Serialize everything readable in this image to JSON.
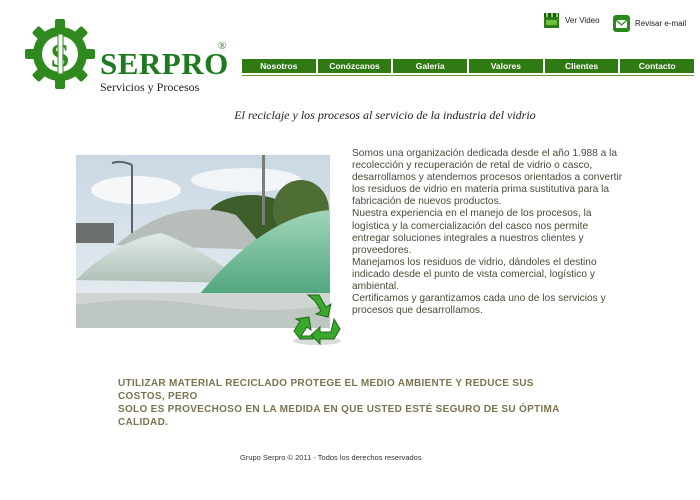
{
  "logo": {
    "name": "SERPRO",
    "registered": "®",
    "subtitle": "Servicios y Procesos"
  },
  "top_links": {
    "video": "Ver Video",
    "email": "Revisar  e-mail"
  },
  "nav": [
    "Nosotros",
    "Conózcanos",
    "Galeria",
    "Valores",
    "Clientes",
    "Contacto"
  ],
  "tagline": "El reciclaje y los procesos al servicio de la industria del vidrio",
  "body": [
    "Somos  una organización dedicada desde el año 1.988 a la recolección y recuperación de retal de vidrio o casco, desarrollamos y atendemos procesos orientados a convertir los residuos de vidrio  en materia prima sustitutiva para la fabricación de nuevos productos.",
    "Nuestra experiencia en el manejo de los procesos, la logística y  la comercialización del casco nos permite entregar soluciones integrales a  nuestros clientes y proveedores.",
    "Manejamos los residuos de vidrio, dándoles el destino indicado desde el punto de vista comercial, logístico y ambiental.",
    "Certificamos y garantizamos cada uno de los servicios y procesos que desarrollamos."
  ],
  "slogan": {
    "line1": "UTILIZAR MATERIAL RECICLADO PROTEGE EL MEDIO AMBIENTE Y REDUCE SUS COSTOS, PERO",
    "line2": "SOLO ES PROVECHOSO EN LA MEDIDA EN QUE USTED ESTÉ SEGURO DE SU ÓPTIMA CALIDAD."
  },
  "footer": "Grupo Serpro © 2011 - Todos los derechos reservados",
  "colors": {
    "brand_green": "#2f7a12",
    "logo_green": "#1e7a1e",
    "slogan": "#7a7450"
  }
}
